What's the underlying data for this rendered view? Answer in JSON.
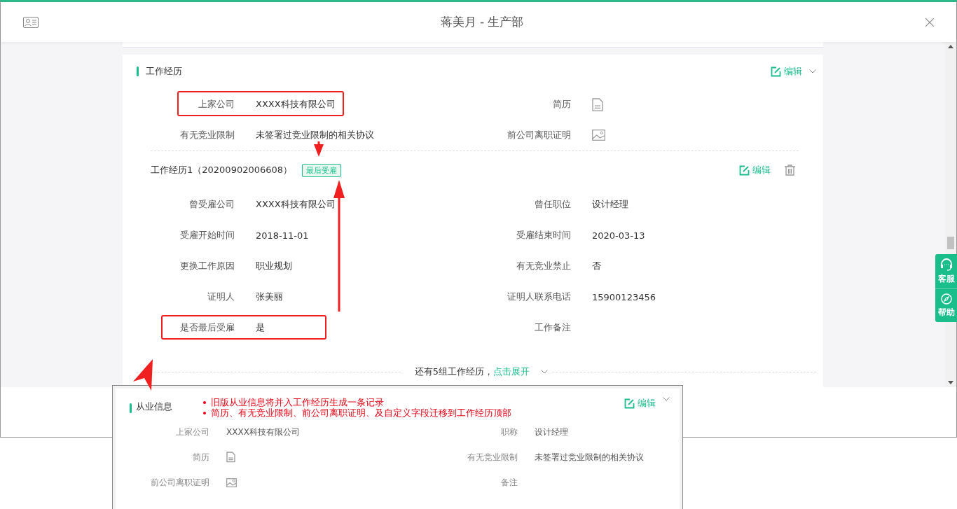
{
  "window": {
    "title": "蒋美月 - 生产部"
  },
  "work_history": {
    "title": "工作经历",
    "edit": "编辑",
    "fields": [
      {
        "label": "上家公司",
        "kind": "text",
        "value": "XXXX科技有限公司"
      },
      {
        "label": "简历",
        "kind": "file"
      },
      {
        "label": "有无竞业限制",
        "kind": "text",
        "value": "未签署过竞业限制的相关协议"
      },
      {
        "label": "前公司离职证明",
        "kind": "image"
      }
    ],
    "records": [
      {
        "title": "工作经历1（20200902006608）",
        "badge": "最后受雇",
        "edit": "编辑",
        "fields": [
          {
            "label": "曾受雇公司",
            "kind": "text",
            "value": "XXXX科技有限公司"
          },
          {
            "label": "曾任职位",
            "kind": "text",
            "value": "设计经理"
          },
          {
            "label": "受雇开始时间",
            "kind": "text",
            "value": "2018-11-01"
          },
          {
            "label": "受雇结束时间",
            "kind": "text",
            "value": "2020-03-13"
          },
          {
            "label": "更换工作原因",
            "kind": "text",
            "value": "职业规划"
          },
          {
            "label": "有无竞业禁止",
            "kind": "text",
            "value": "否"
          },
          {
            "label": "证明人",
            "kind": "text",
            "value": "张美丽"
          },
          {
            "label": "证明人联系电话",
            "kind": "text",
            "value": "15900123456"
          },
          {
            "label": "是否最后受雇",
            "kind": "text",
            "value": "是"
          },
          {
            "label": "工作备注",
            "kind": "text"
          }
        ]
      }
    ],
    "expand": {
      "text": "还有5组工作经历，",
      "link": "点击展开"
    }
  },
  "side_buttons": [
    {
      "kind": "support",
      "label": "客服"
    },
    {
      "kind": "help",
      "label": "帮助"
    }
  ],
  "legacy_panel": {
    "title": "从业信息",
    "notes": [
      "旧版从业信息将并入工作经历生成一条记录",
      "简历、有无竞业限制、前公司离职证明、及自定义字段迁移到工作经历顶部"
    ],
    "edit": "编辑",
    "fields": [
      {
        "label": "上家公司",
        "kind": "text",
        "value": "XXXX科技有限公司"
      },
      {
        "label": "职称",
        "kind": "text",
        "value": "设计经理"
      },
      {
        "label": "简历",
        "kind": "file"
      },
      {
        "label": "有无竞业限制",
        "kind": "text",
        "value": "未签署过竞业限制的相关协议"
      },
      {
        "label": "前公司离职证明",
        "kind": "image"
      },
      {
        "label": "备注",
        "kind": "text"
      }
    ]
  }
}
